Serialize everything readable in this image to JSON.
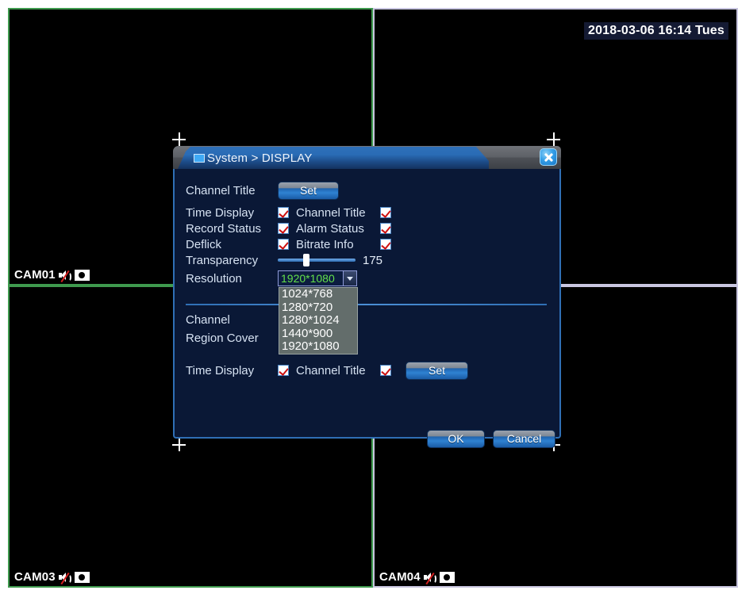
{
  "osd": {
    "timestamp": "2018-03-06 16:14 Tues",
    "cameras": [
      {
        "name": "CAM01",
        "speaker_icon": "speaker-muted-icon",
        "record_icon": "record-icon"
      },
      {
        "name": "",
        "speaker_icon": "",
        "record_icon": ""
      },
      {
        "name": "CAM03",
        "speaker_icon": "speaker-muted-icon",
        "record_icon": "record-icon"
      },
      {
        "name": "CAM04",
        "speaker_icon": "speaker-muted-icon",
        "record_icon": "record-icon"
      }
    ]
  },
  "dialog": {
    "title": "System > DISPLAY",
    "window_icon": "window-icon",
    "close_icon": "close-icon",
    "rows": {
      "channel_title_label": "Channel Title",
      "channel_title_set": "Set",
      "time_display_label": "Time Display",
      "time_display_checked": true,
      "channel_title_sub_label": "Channel Title",
      "channel_title_sub_checked": true,
      "record_status_label": "Record Status",
      "record_status_checked": true,
      "alarm_status_label": "Alarm Status",
      "alarm_status_checked": true,
      "deflick_label": "Deflick",
      "deflick_checked": true,
      "bitrate_info_label": "Bitrate Info",
      "bitrate_info_checked": true,
      "transparency_label": "Transparency",
      "transparency_value": "175",
      "resolution_label": "Resolution",
      "resolution_value": "1920*1080",
      "resolution_options": [
        "1024*768",
        "1280*720",
        "1280*1024",
        "1440*900",
        "1920*1080"
      ],
      "channel_label": "Channel",
      "region_cover_label": "Region Cover",
      "time_display_label2": "Time Display",
      "time_display2_checked": true,
      "channel_title_sub_label2": "Channel Title",
      "channel_title_sub2_checked": true,
      "region_set_label": "Set"
    },
    "footer": {
      "ok_label": "OK",
      "cancel_label": "Cancel"
    }
  },
  "colors": {
    "pane_border_green": "#3f9a4e",
    "pane_border_purple": "#c9c6e0",
    "dialog_body": "#0a1836",
    "accent_blue": "#2f6fb5",
    "select_text_green": "#63e04a",
    "check_red": "#cc1111"
  }
}
